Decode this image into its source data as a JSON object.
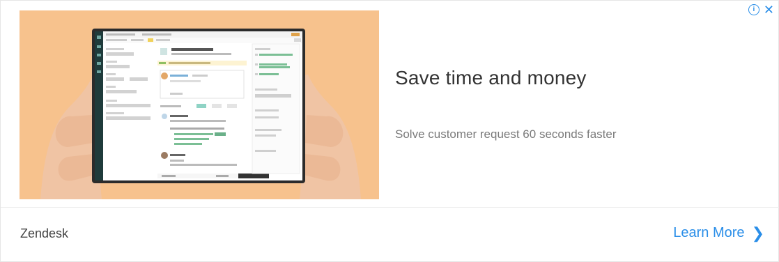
{
  "ad": {
    "headline": "Save time and money",
    "subline": "Solve customer request 60 seconds faster",
    "advertiser": "Zendesk",
    "cta_label": "Learn More",
    "cta_chevron": "❯",
    "adchoices_info": "i",
    "adchoices_close": "✕"
  },
  "icons": {
    "info": "info-icon",
    "close": "close-icon",
    "chevron": "chevron-right-icon"
  },
  "colors": {
    "accent": "#2a8ee8",
    "hero_background": "#f7c28d",
    "tablet_sidebar": "#1f3b3b"
  }
}
